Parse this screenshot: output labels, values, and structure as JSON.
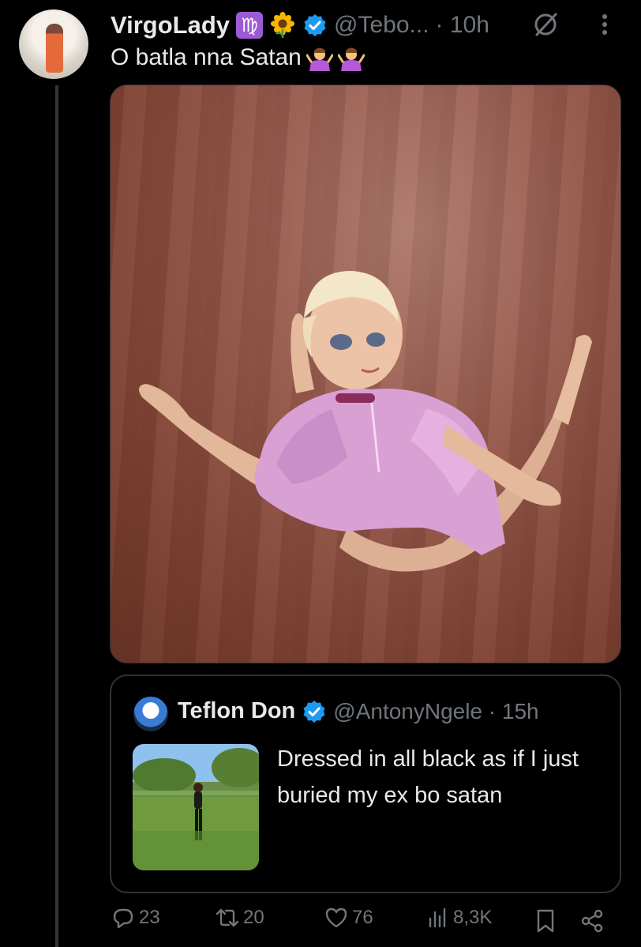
{
  "author": {
    "name": "VirgoLady",
    "zodiac_badge": "♍",
    "flower_emoji": "sunflower-icon",
    "handle": "@Tebo...",
    "time": "· 10h"
  },
  "tweet": {
    "text": "O batla nna Satan",
    "emojis": [
      "person-shrugging-icon",
      "person-shrugging-icon"
    ]
  },
  "quoted": {
    "name": "Teflon Don",
    "handle_time": "@AntonyNgele · 15h",
    "text": "Dressed in all black as if I just buried my ex bo satan"
  },
  "actions": {
    "replies": "23",
    "retweets": "20",
    "likes": "76",
    "views": "8,3K"
  },
  "colors": {
    "background": "#000000",
    "text": "#e7e9ea",
    "secondary_text": "#71767b",
    "verified": "#1d9bf0",
    "border": "#2f3336"
  }
}
